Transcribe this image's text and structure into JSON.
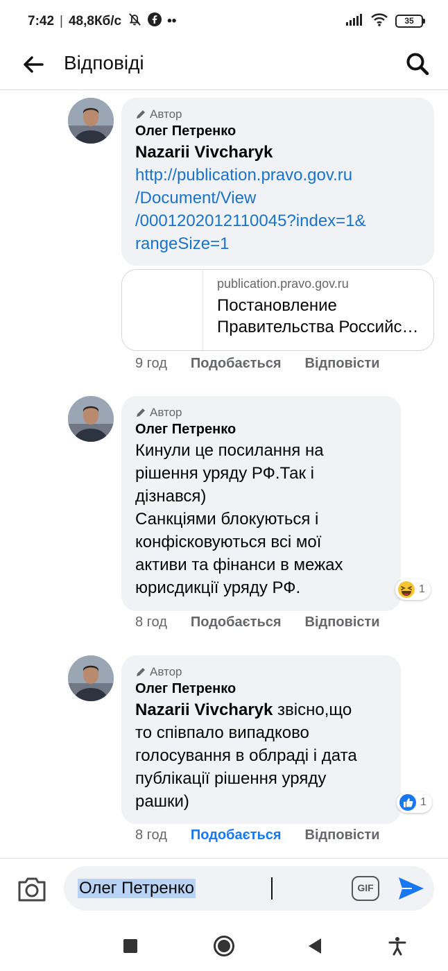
{
  "status_bar": {
    "time": "7:42",
    "separator": "|",
    "speed": "48,8Кб/с",
    "more": "••",
    "battery": "35"
  },
  "header": {
    "title": "Відповіді"
  },
  "comments": [
    {
      "badge": "Автор",
      "author": "Олег Петренко",
      "mention": "Nazarii Vivcharyk",
      "link_lines": [
        "http://publication.pravo.gov.ru",
        "/Document/View",
        "/0001202012110045?index=1&",
        "rangeSize=1"
      ],
      "preview": {
        "domain": "publication.pravo.gov.ru",
        "title_line1": "Постановление",
        "title_line2": "Правительства Российской Федерации"
      },
      "time": "9 год",
      "like": "Подобається",
      "reply": "Відповісти"
    },
    {
      "badge": "Автор",
      "author": "Олег Петренко",
      "text_lines": [
        "Кинули це посилання на",
        "рішення уряду РФ.Так і",
        "дізнався)",
        "Санкціями блокуються і",
        "конфісковуються всі мої",
        "активи та фінанси в межах",
        "юрисдикції уряду РФ."
      ],
      "reaction": {
        "icon": "haha-emoji-icon",
        "count": "1"
      },
      "time": "8 год",
      "like": "Подобається",
      "reply": "Відповісти"
    },
    {
      "badge": "Автор",
      "author": "Олег Петренко",
      "mention": "Nazarii Vivcharyk",
      "first_line_rest": " звісно,що",
      "text_lines": [
        "то співпало випадково",
        "голосування в облраді і дата",
        "публікації рішення уряду",
        "рашки)"
      ],
      "reaction": {
        "icon": "like-thumb-icon",
        "count": "1"
      },
      "time": "8 год",
      "like": "Подобається",
      "like_active": true,
      "reply": "Відповісти"
    }
  ],
  "composer": {
    "value": "Олег Петренко",
    "gif_label": "GIF"
  },
  "colors": {
    "bubble": "#f0f2f5",
    "link": "#1a73c9",
    "accent": "#1877f2",
    "meta": "#65676b"
  }
}
